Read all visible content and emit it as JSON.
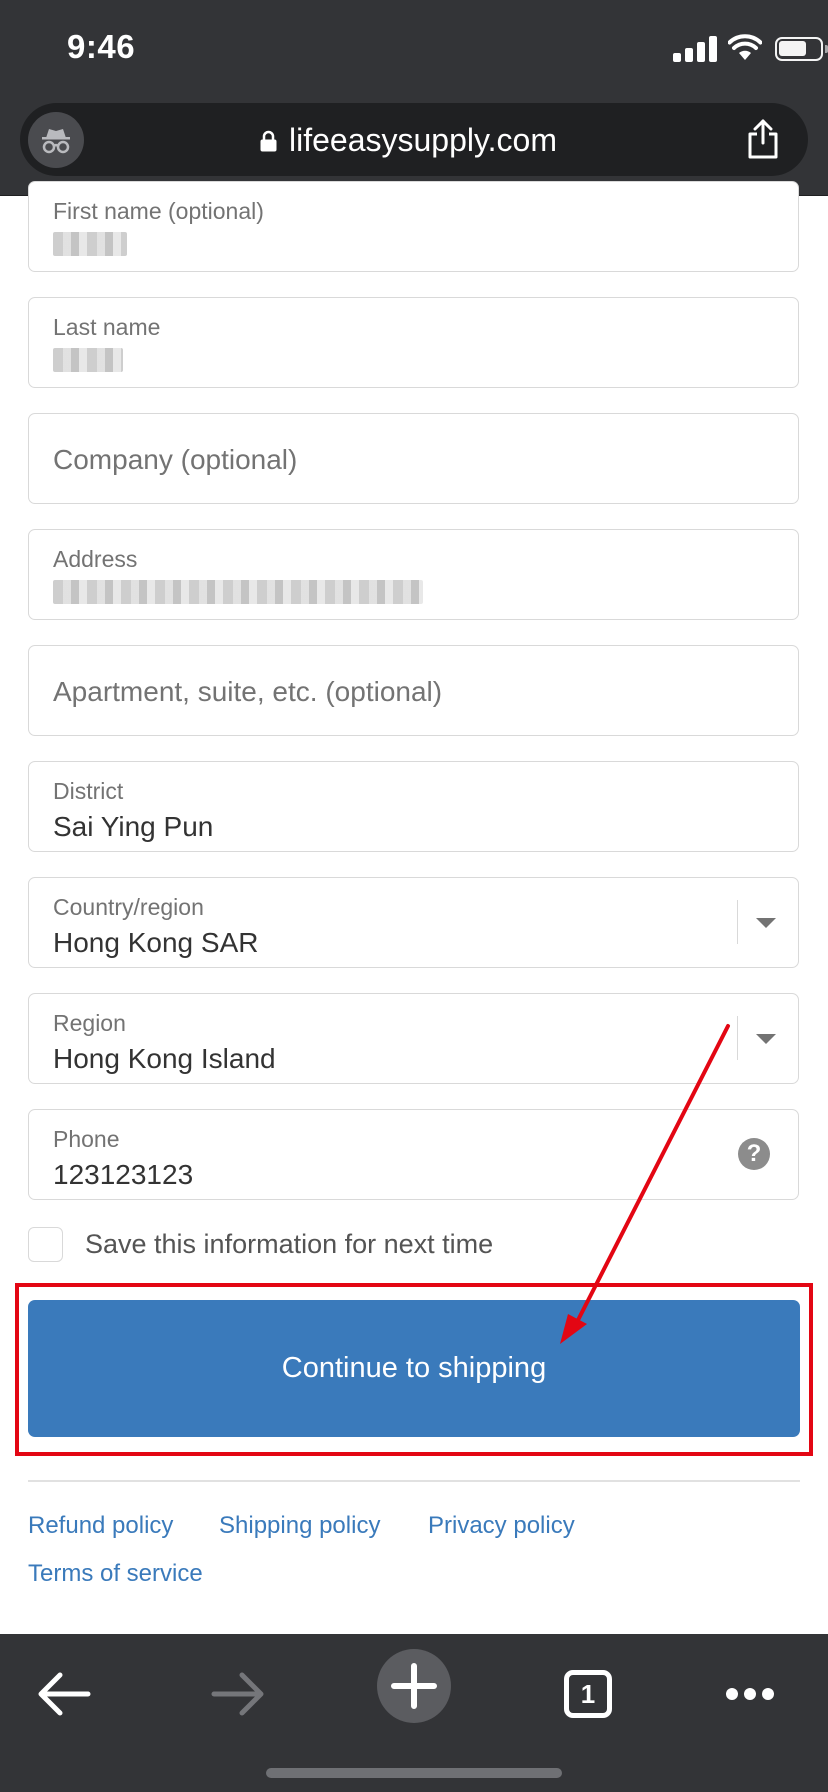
{
  "status_bar": {
    "time": "9:46",
    "battery_level": 0.7
  },
  "browser": {
    "url": "lifeeasysupply.com"
  },
  "form": {
    "first_name": {
      "label": "First name (optional)"
    },
    "last_name": {
      "label": "Last name"
    },
    "company": {
      "placeholder": "Company (optional)"
    },
    "address": {
      "label": "Address"
    },
    "apartment": {
      "placeholder": "Apartment, suite, etc. (optional)"
    },
    "district": {
      "label": "District",
      "value": "Sai Ying Pun"
    },
    "country": {
      "label": "Country/region",
      "value": "Hong Kong SAR"
    },
    "region": {
      "label": "Region",
      "value": "Hong Kong Island"
    },
    "phone": {
      "label": "Phone",
      "value": "123123123",
      "help_symbol": "?"
    },
    "save_info": {
      "label": "Save this information for next time",
      "checked": false
    }
  },
  "continue_button": {
    "label": "Continue to shipping"
  },
  "annotation": {
    "highlight_color": "#e30613"
  },
  "policies": {
    "refund": "Refund policy",
    "shipping": "Shipping policy",
    "privacy": "Privacy policy",
    "terms": "Terms of service"
  },
  "toolbar": {
    "tab_count": "1"
  },
  "colors": {
    "accent": "#3a7abb",
    "chrome": "#333437"
  }
}
